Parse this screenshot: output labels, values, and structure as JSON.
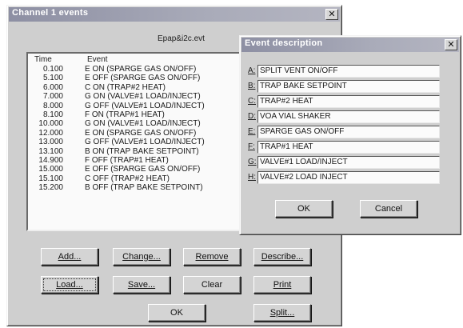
{
  "main_window": {
    "title": "Channel 1 events",
    "close_glyph": "✕",
    "filename": "Epap&i2c.evt",
    "columns": {
      "time": "Time",
      "event": "Event"
    },
    "events": [
      {
        "time": "0.100",
        "event": "E ON (SPARGE GAS ON/OFF)"
      },
      {
        "time": "5.100",
        "event": "E OFF (SPARGE GAS ON/OFF)"
      },
      {
        "time": "6.000",
        "event": "C ON (TRAP#2 HEAT)"
      },
      {
        "time": "7.000",
        "event": "G ON (VALVE#1  LOAD/INJECT)"
      },
      {
        "time": "8.000",
        "event": "G OFF (VALVE#1  LOAD/INJECT)"
      },
      {
        "time": "8.100",
        "event": "F ON (TRAP#1 HEAT)"
      },
      {
        "time": "10.000",
        "event": "G ON (VALVE#1  LOAD/INJECT)"
      },
      {
        "time": "12.000",
        "event": "E ON (SPARGE GAS ON/OFF)"
      },
      {
        "time": "13.000",
        "event": "G OFF (VALVE#1  LOAD/INJECT)"
      },
      {
        "time": "13.100",
        "event": "B ON (TRAP BAKE SETPOINT)"
      },
      {
        "time": "14.900",
        "event": "F OFF (TRAP#1 HEAT)"
      },
      {
        "time": "15.000",
        "event": "E OFF (SPARGE GAS ON/OFF)"
      },
      {
        "time": "15.100",
        "event": "C OFF (TRAP#2 HEAT)"
      },
      {
        "time": "15.200",
        "event": "B OFF (TRAP BAKE SETPOINT)"
      }
    ],
    "buttons": {
      "add": "Add...",
      "change": "Change...",
      "remove": "Remove",
      "describe": "Describe...",
      "load": "Load...",
      "save": "Save...",
      "clear": "Clear",
      "print": "Print",
      "ok": "OK",
      "split": "Split..."
    }
  },
  "description_dialog": {
    "title": "Event description",
    "close_glyph": "✕",
    "items": [
      {
        "key": "A:",
        "value": "SPLIT VENT ON/OFF"
      },
      {
        "key": "B:",
        "value": "TRAP BAKE SETPOINT"
      },
      {
        "key": "C:",
        "value": "TRAP#2 HEAT"
      },
      {
        "key": "D:",
        "value": "VOA VIAL SHAKER"
      },
      {
        "key": "E:",
        "value": "SPARGE GAS ON/OFF"
      },
      {
        "key": "F:",
        "value": "TRAP#1 HEAT"
      },
      {
        "key": "G:",
        "value": "VALVE#1  LOAD/INJECT"
      },
      {
        "key": "H:",
        "value": "VALVE#2 LOAD INJECT"
      }
    ],
    "buttons": {
      "ok": "OK",
      "cancel": "Cancel"
    }
  }
}
